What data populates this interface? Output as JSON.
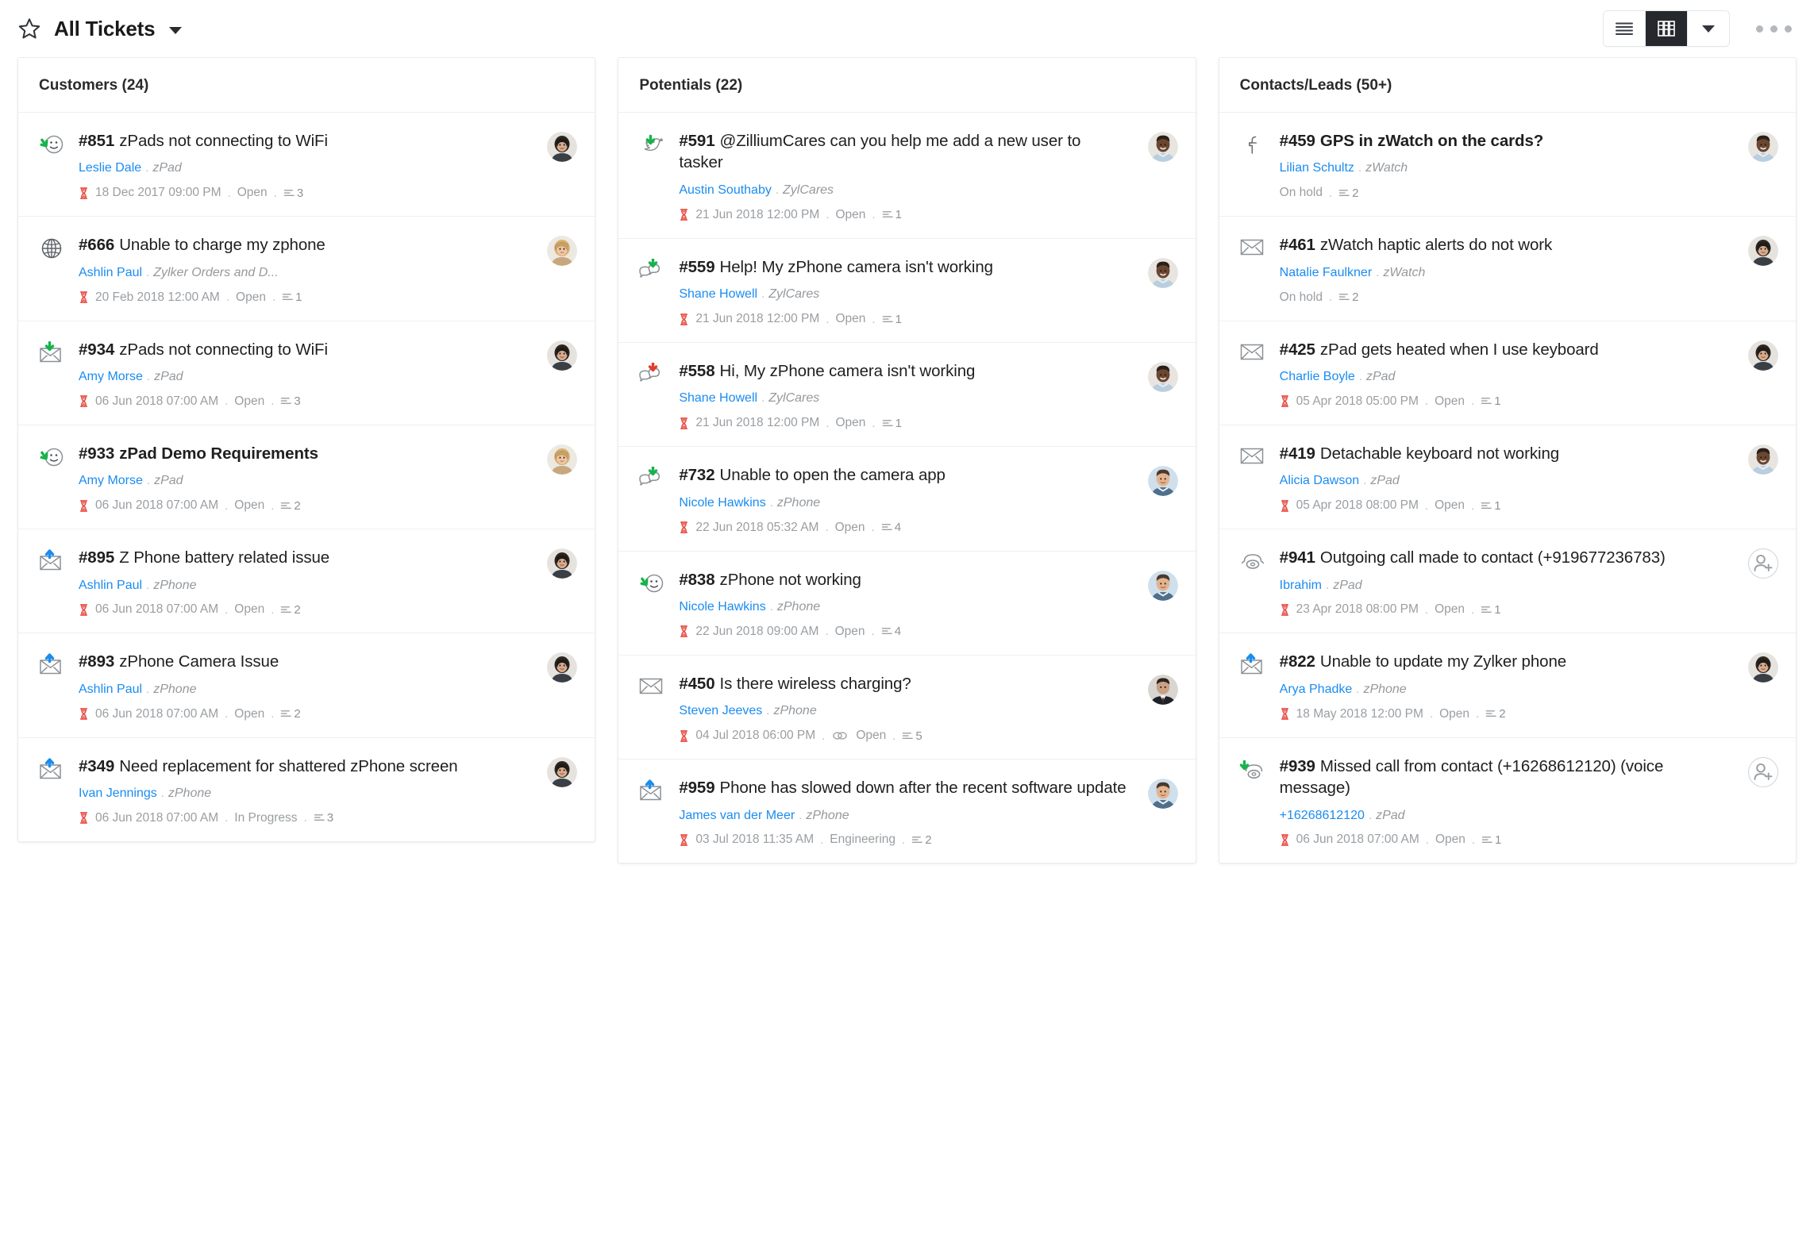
{
  "header": {
    "star_icon": "star-outline-icon",
    "title": "All Tickets",
    "caret_icon": "chevron-down-icon",
    "view_list_icon": "list-view-icon",
    "view_board_icon": "board-view-icon",
    "view_caret_icon": "chevron-down-icon",
    "more_icon": "more-options-icon"
  },
  "columns": [
    {
      "title": "Customers",
      "count": "(24)",
      "cards": [
        {
          "icon": "smiley-reply-icon",
          "num": "#851",
          "title": "zPads not connecting to WiFi",
          "bold": false,
          "contact": "Leslie Dale",
          "product": "zPad",
          "due": "18 Dec 2017 09:00 PM",
          "status": "Open",
          "threads": "3",
          "avatar": "woman-dark-hair"
        },
        {
          "icon": "globe-icon",
          "num": "#666",
          "title": "Unable to charge my zphone",
          "bold": false,
          "contact": "Ashlin Paul",
          "product": "Zylker Orders and D...",
          "due": "20 Feb 2018 12:00 AM",
          "status": "Open",
          "threads": "1",
          "avatar": "woman-blonde"
        },
        {
          "icon": "email-received-icon",
          "num": "#934",
          "title": "zPads not connecting to WiFi",
          "bold": false,
          "contact": "Amy Morse",
          "product": "zPad",
          "due": "06 Jun 2018 07:00 AM",
          "status": "Open",
          "threads": "3",
          "avatar": "woman-dark-hair"
        },
        {
          "icon": "smiley-reply-icon",
          "num": "#933",
          "title": "zPad Demo Requirements",
          "bold": true,
          "contact": "Amy Morse",
          "product": "zPad",
          "due": "06 Jun 2018 07:00 AM",
          "status": "Open",
          "threads": "2",
          "avatar": "woman-blonde"
        },
        {
          "icon": "email-sent-icon",
          "num": "#895",
          "title": "Z Phone battery related issue",
          "bold": false,
          "contact": "Ashlin Paul",
          "product": "zPhone",
          "due": "06 Jun 2018 07:00 AM",
          "status": "Open",
          "threads": "2",
          "avatar": "woman-dark-hair"
        },
        {
          "icon": "email-sent-icon",
          "num": "#893",
          "title": "zPhone Camera Issue",
          "bold": false,
          "contact": "Ashlin Paul",
          "product": "zPhone",
          "due": "06 Jun 2018 07:00 AM",
          "status": "Open",
          "threads": "2",
          "avatar": "woman-dark-hair"
        },
        {
          "icon": "email-sent-icon",
          "num": "#349",
          "title": "Need replacement for shattered zPhone screen",
          "bold": false,
          "contact": "Ivan Jennings",
          "product": "zPhone",
          "due": "06 Jun 2018 07:00 AM",
          "status": "In Progress",
          "threads": "3",
          "avatar": "woman-dark-hair"
        }
      ]
    },
    {
      "title": "Potentials",
      "count": "(22)",
      "cards": [
        {
          "icon": "twitter-reply-icon",
          "num": "#591",
          "title": "@ZilliumCares can you help me add a new user to tasker",
          "bold": false,
          "contact": "Austin Southaby",
          "product": "ZylCares",
          "due": "21 Jun 2018 12:00 PM",
          "status": "Open",
          "threads": "1",
          "avatar": "man-dark-skin"
        },
        {
          "icon": "chat-received-icon",
          "num": "#559",
          "title": "Help! My zPhone camera isn't working",
          "bold": false,
          "contact": "Shane Howell",
          "product": "ZylCares",
          "due": "21 Jun 2018 12:00 PM",
          "status": "Open",
          "threads": "1",
          "avatar": "man-dark-skin"
        },
        {
          "icon": "chat-missed-icon",
          "num": "#558",
          "title": "Hi, My zPhone camera isn't working",
          "bold": false,
          "contact": "Shane Howell",
          "product": "ZylCares",
          "due": "21 Jun 2018 12:00 PM",
          "status": "Open",
          "threads": "1",
          "avatar": "man-dark-skin"
        },
        {
          "icon": "chat-received-icon",
          "num": "#732",
          "title": "Unable to open the camera app",
          "bold": false,
          "contact": "Nicole Hawkins",
          "product": "zPhone",
          "due": "22 Jun 2018 05:32 AM",
          "status": "Open",
          "threads": "4",
          "avatar": "man-light-blue"
        },
        {
          "icon": "smiley-reply-icon",
          "num": "#838",
          "title": "zPhone not working",
          "bold": false,
          "contact": "Nicole Hawkins",
          "product": "zPhone",
          "due": "22 Jun 2018 09:00 AM",
          "status": "Open",
          "threads": "4",
          "avatar": "man-light-blue"
        },
        {
          "icon": "email-icon",
          "num": "#450",
          "title": "Is there wireless charging?",
          "bold": false,
          "contact": "Steven Jeeves",
          "product": "zPhone",
          "due": "04 Jul 2018 06:00 PM",
          "status": "Open",
          "status_icon": "attachment-icon",
          "threads": "5",
          "avatar": "man-suit"
        },
        {
          "icon": "email-sent-icon",
          "num": "#959",
          "title": "Phone has slowed down after the recent software update",
          "bold": false,
          "contact": "James van der Meer",
          "product": "zPhone",
          "due": "03 Jul 2018 11:35 AM",
          "status": "Engineering",
          "threads": "2",
          "avatar": "man-light-blue"
        }
      ]
    },
    {
      "title": "Contacts/Leads",
      "count": "(50+)",
      "cards": [
        {
          "icon": "facebook-icon",
          "num": "#459",
          "title": "GPS in zWatch on the cards?",
          "bold": true,
          "contact": "Lilian Schultz",
          "product": "zWatch",
          "due": "",
          "status": "On hold",
          "threads": "2",
          "avatar": "man-dark-skin"
        },
        {
          "icon": "email-icon",
          "num": "#461",
          "title": "zWatch haptic alerts do not work",
          "bold": false,
          "contact": "Natalie Faulkner",
          "product": "zWatch",
          "due": "",
          "status": "On hold",
          "threads": "2",
          "avatar": "woman-dark-hair"
        },
        {
          "icon": "email-icon",
          "num": "#425",
          "title": "zPad gets heated when I use keyboard",
          "bold": false,
          "contact": "Charlie Boyle",
          "product": "zPad",
          "due": "05 Apr 2018 05:00 PM",
          "status": "Open",
          "threads": "1",
          "avatar": "woman-dark-hair"
        },
        {
          "icon": "email-icon",
          "num": "#419",
          "title": "Detachable keyboard not working",
          "bold": false,
          "contact": "Alicia Dawson",
          "product": "zPad",
          "due": "05 Apr 2018 08:00 PM",
          "status": "Open",
          "threads": "1",
          "avatar": "man-dark-skin"
        },
        {
          "icon": "phone-icon",
          "num": "#941",
          "title": "Outgoing call made to contact (+919677236783)",
          "bold": false,
          "contact": "Ibrahim",
          "product": "zPad",
          "due": "23 Apr 2018 08:00 PM",
          "status": "Open",
          "threads": "1",
          "avatar": "add-person-placeholder"
        },
        {
          "icon": "email-sent-icon",
          "num": "#822",
          "title": "Unable to update my Zylker phone",
          "bold": false,
          "contact": "Arya Phadke",
          "product": "zPhone",
          "due": "18 May 2018 12:00 PM",
          "status": "Open",
          "threads": "2",
          "avatar": "woman-dark-hair"
        },
        {
          "icon": "phone-missed-icon",
          "num": "#939",
          "title": "Missed call from contact (+16268612120) (voice message)",
          "bold": false,
          "contact": "+16268612120",
          "product": "zPad",
          "due": "06 Jun 2018 07:00 AM",
          "status": "Open",
          "threads": "1",
          "avatar": "add-person-placeholder"
        }
      ]
    }
  ],
  "colors": {
    "link": "#1a8cf0",
    "muted": "#9a9ea2",
    "green_arrow": "#16b34a",
    "red_arrow": "#e23b2e",
    "blue_arrow": "#1a8cf0",
    "active_toggle_bg": "#25282d"
  }
}
